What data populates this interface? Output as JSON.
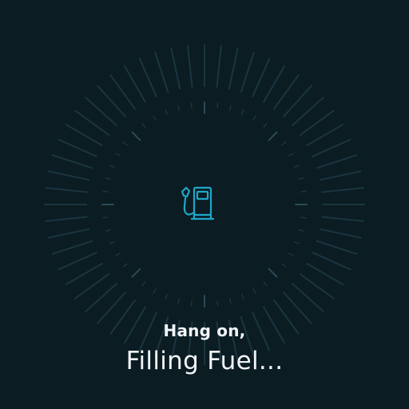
{
  "loader": {
    "icon": "fuel-pump-icon",
    "accent_color": "#1ea7c9",
    "background_color": "#0b1c23",
    "tick_color": "#1b3540"
  },
  "message": {
    "line1": "Hang on,",
    "line2": "Filling Fuel..."
  }
}
